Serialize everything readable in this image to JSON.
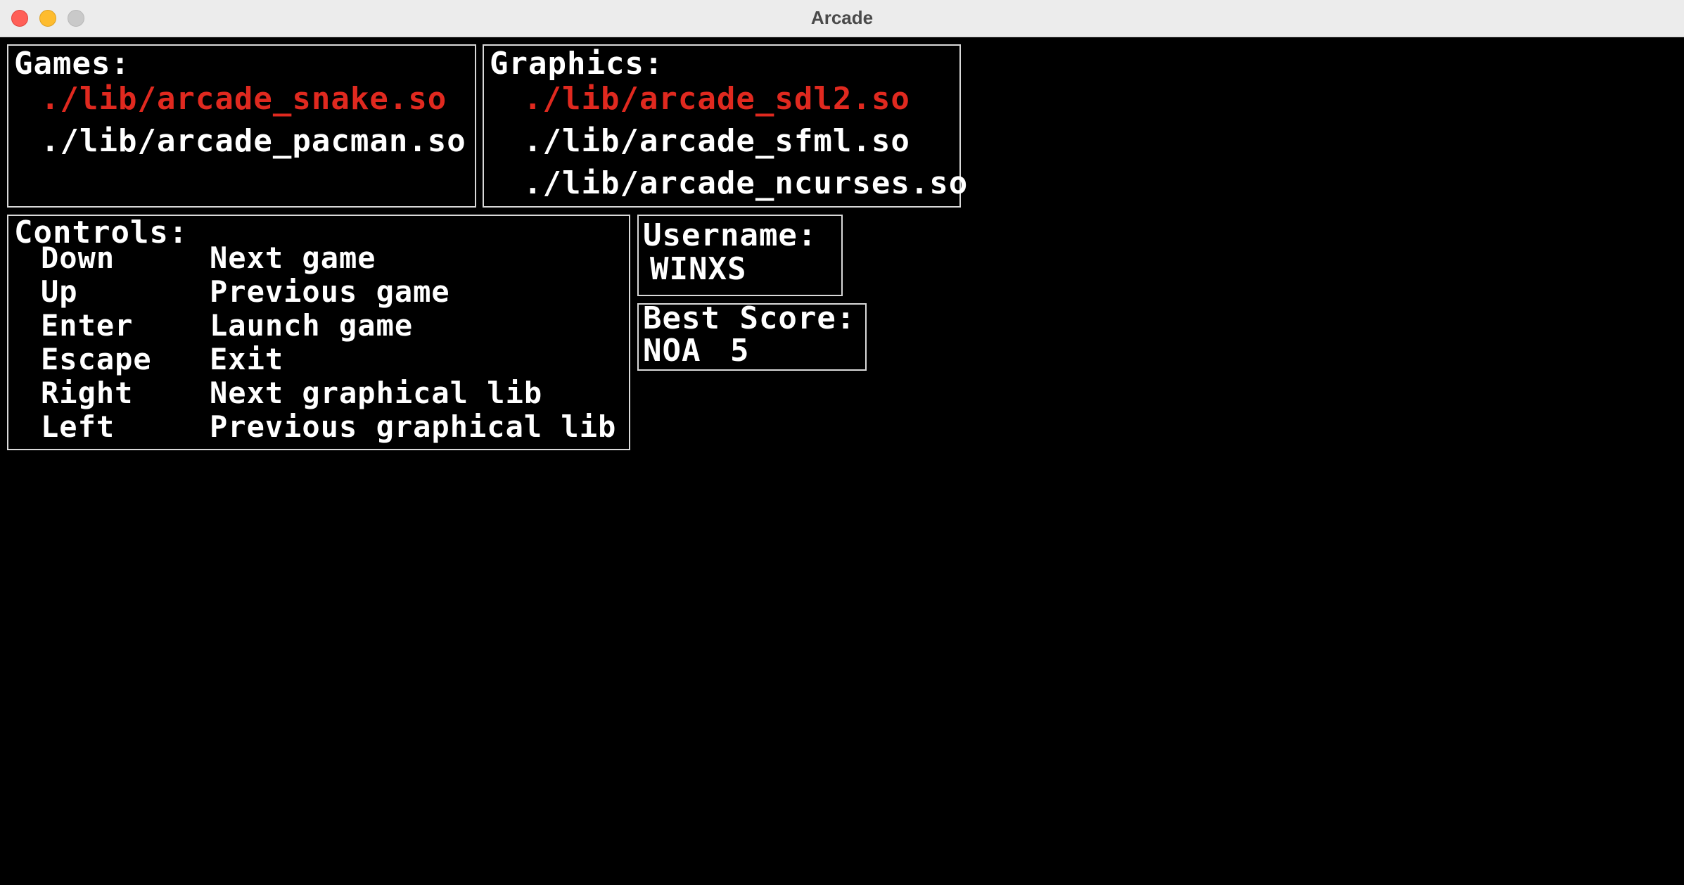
{
  "window": {
    "title": "Arcade"
  },
  "games": {
    "header": "Games:",
    "items": [
      "./lib/arcade_snake.so",
      "./lib/arcade_pacman.so"
    ],
    "selected_index": 0
  },
  "graphics": {
    "header": "Graphics:",
    "items": [
      "./lib/arcade_sdl2.so",
      "./lib/arcade_sfml.so",
      "./lib/arcade_ncurses.so"
    ],
    "selected_index": 0
  },
  "controls": {
    "header": "Controls:",
    "rows": [
      {
        "key": "Down",
        "action": "Next game"
      },
      {
        "key": "Up",
        "action": "Previous game"
      },
      {
        "key": "Enter",
        "action": "Launch game"
      },
      {
        "key": "Escape",
        "action": "Exit"
      },
      {
        "key": "Right",
        "action": "Next graphical lib"
      },
      {
        "key": "Left",
        "action": "Previous graphical lib"
      }
    ]
  },
  "username": {
    "header": "Username:",
    "value": "WINXS"
  },
  "best_score": {
    "header": "Best Score:",
    "name": "NOA",
    "score": "5"
  },
  "colors": {
    "background": "#000000",
    "text": "#ffffff",
    "selected": "#e0291f",
    "border": "#d9d9d9"
  }
}
